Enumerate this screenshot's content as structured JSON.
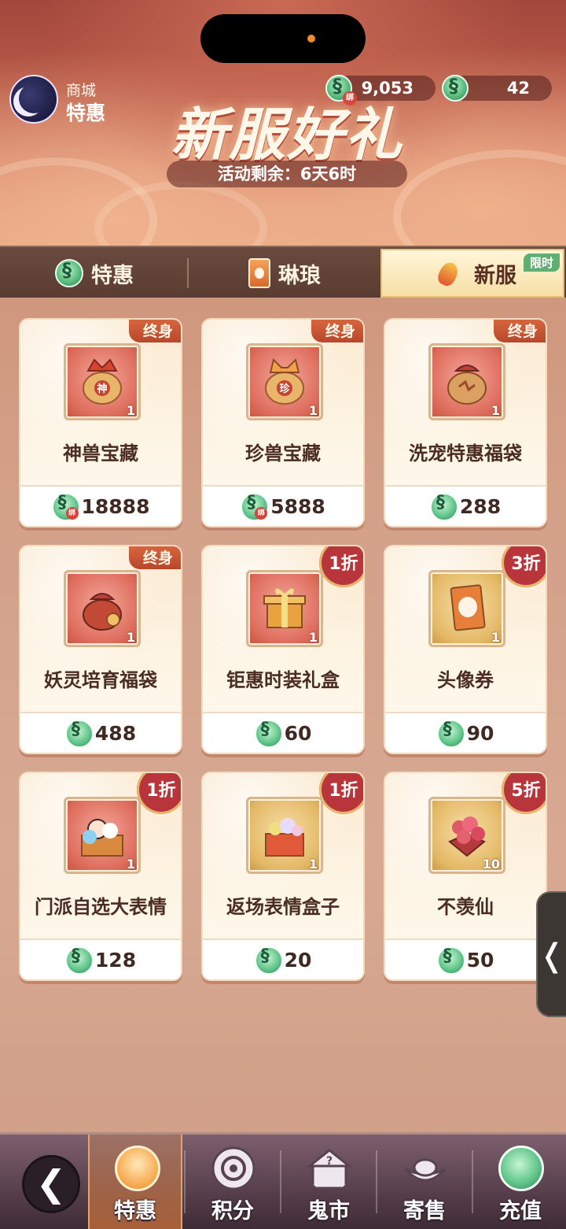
{
  "header": {
    "shop_label": "商城",
    "shop_sub": "特惠",
    "event_title": "新服好礼",
    "timer_text": "活动剩余：6天6时",
    "currency_bound": "9,053",
    "currency_main": "42",
    "bound_tag": "绑"
  },
  "tabs": [
    {
      "label": "特惠",
      "icon": "jade-coin-icon"
    },
    {
      "label": "琳琅",
      "icon": "card-icon"
    },
    {
      "label": "新服",
      "icon": "firework-icon",
      "badge": "限时",
      "active": true
    }
  ],
  "items": [
    {
      "name": "神兽宝藏",
      "price": "18888",
      "bound": true,
      "qty": "1",
      "tag": "终身",
      "art": "神"
    },
    {
      "name": "珍兽宝藏",
      "price": "5888",
      "bound": true,
      "qty": "1",
      "tag": "终身",
      "art": "珍"
    },
    {
      "name": "洗宠特惠福袋",
      "price": "288",
      "bound": false,
      "qty": "1",
      "tag": "终身"
    },
    {
      "name": "妖灵培育福袋",
      "price": "488",
      "bound": false,
      "qty": "1",
      "tag": "终身"
    },
    {
      "name": "钜惠时装礼盒",
      "price": "60",
      "bound": false,
      "qty": "1",
      "discount": "1折"
    },
    {
      "name": "头像券",
      "price": "90",
      "bound": false,
      "qty": "1",
      "discount": "3折"
    },
    {
      "name": "门派自选大表情",
      "price": "128",
      "bound": false,
      "qty": "1",
      "discount": "1折"
    },
    {
      "name": "返场表情盒子",
      "price": "20",
      "bound": false,
      "qty": "1",
      "discount": "1折"
    },
    {
      "name": "不羡仙",
      "price": "50",
      "bound": false,
      "qty": "10",
      "discount": "5折"
    }
  ],
  "side_tab": "❬",
  "bottom_nav": [
    {
      "label": "特惠",
      "active": true
    },
    {
      "label": "积分"
    },
    {
      "label": "鬼市"
    },
    {
      "label": "寄售"
    },
    {
      "label": "充值"
    }
  ],
  "colors": {
    "accent": "#b8363b",
    "tab_active": "#f6dfa6",
    "ribbon": "#c9552f",
    "jade": "#5cc287"
  }
}
